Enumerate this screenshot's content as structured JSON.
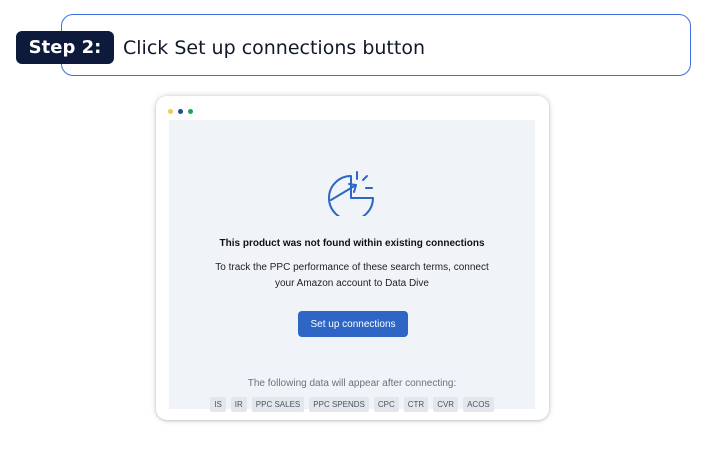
{
  "step": {
    "badge": "Step 2:",
    "instruction": "Click Set up connections button"
  },
  "window": {
    "dot_colors": [
      "#f6c844",
      "#1d4c9f",
      "#1aa35a"
    ],
    "accent": "#2d66c4",
    "icon": "pie-chart-growth-icon",
    "title": "This product was not found within existing connections",
    "description": "To track the PPC performance of these search terms, connect your Amazon account to Data Dive",
    "button_label": "Set up connections",
    "after_connect_text": "The following data will appear after connecting:",
    "tags": [
      "IS",
      "IR",
      "PPC SALES",
      "PPC SPENDS",
      "CPC",
      "CTR",
      "CVR",
      "ACOS"
    ]
  }
}
